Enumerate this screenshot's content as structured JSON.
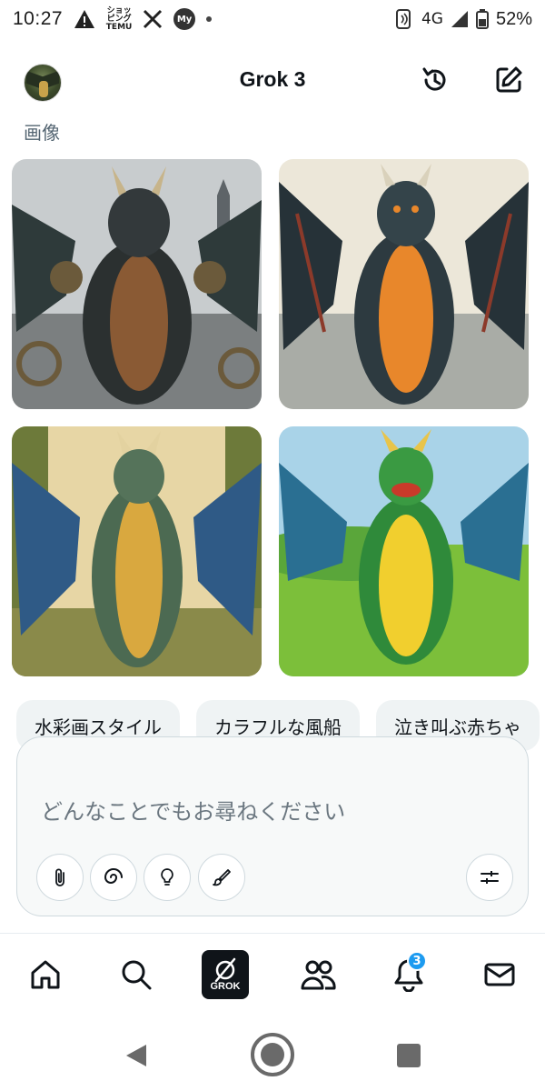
{
  "status_bar": {
    "time": "10:27",
    "network": "4G",
    "battery": "52%",
    "icons": [
      "warning-icon",
      "temu-icon",
      "x-icon",
      "my-docomo-icon",
      "dot-icon",
      "nfc-icon",
      "signal-icon",
      "battery-icon"
    ],
    "temu_label": "ショッピング TEMU",
    "my_label": "My"
  },
  "header": {
    "title": "Grok 3",
    "icons": [
      "avatar",
      "history-icon",
      "compose-icon"
    ]
  },
  "section_label": "画像",
  "images": [
    {
      "style": "steampunk dragon",
      "icon": "dragon-image-1"
    },
    {
      "style": "orange-belly dragon",
      "icon": "dragon-image-2"
    },
    {
      "style": "painted dragon",
      "icon": "dragon-image-3"
    },
    {
      "style": "cartoon dragon",
      "icon": "dragon-image-4"
    }
  ],
  "suggestions": [
    "水彩画スタイル",
    "カラフルな風船",
    "泣き叫ぶ赤ちゃ"
  ],
  "input": {
    "placeholder": "どんなことでもお尋ねください",
    "tools": [
      "attach-icon",
      "spiral-icon",
      "lightbulb-icon",
      "brush-icon",
      "sliders-icon"
    ]
  },
  "bottom_nav": {
    "items": [
      "home-icon",
      "search-icon",
      "grok-icon",
      "people-icon",
      "notifications-icon",
      "mail-icon"
    ],
    "grok_label": "GROK",
    "notification_count": "3"
  },
  "colors": {
    "accent": "#1d9bf0",
    "text": "#0f1419",
    "muted": "#536471",
    "chip_bg": "#eff3f4"
  }
}
